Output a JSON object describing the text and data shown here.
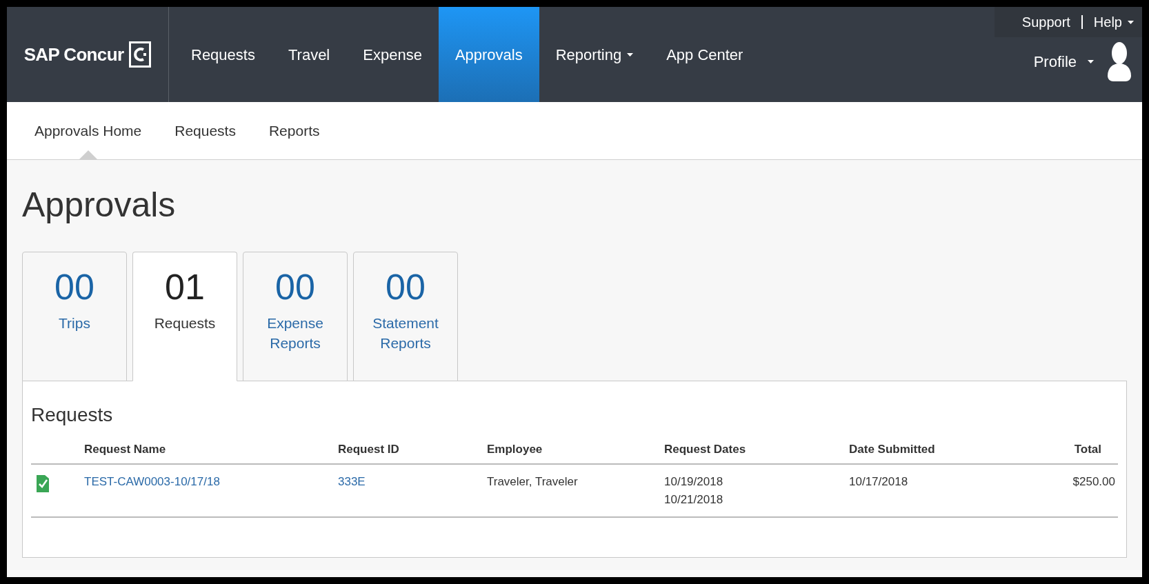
{
  "brand": {
    "name": "SAP Concur"
  },
  "nav": [
    {
      "label": "Requests",
      "selected": false,
      "dropdown": false
    },
    {
      "label": "Travel",
      "selected": false,
      "dropdown": false
    },
    {
      "label": "Expense",
      "selected": false,
      "dropdown": false
    },
    {
      "label": "Approvals",
      "selected": true,
      "dropdown": false
    },
    {
      "label": "Reporting",
      "selected": false,
      "dropdown": true
    },
    {
      "label": "App Center",
      "selected": false,
      "dropdown": false
    }
  ],
  "utility_links": [
    {
      "label": "Support",
      "dropdown": false
    },
    {
      "label": "Help",
      "dropdown": true
    }
  ],
  "profile": {
    "label": "Profile"
  },
  "subnav": [
    {
      "label": "Approvals Home",
      "selected": true
    },
    {
      "label": "Requests",
      "selected": false
    },
    {
      "label": "Reports",
      "selected": false
    }
  ],
  "page_title": "Approvals",
  "tabs": [
    {
      "count": "00",
      "label": "Trips",
      "selected": false
    },
    {
      "count": "01",
      "label": "Requests",
      "selected": true
    },
    {
      "count": "00",
      "label": "Expense Reports",
      "selected": false
    },
    {
      "count": "00",
      "label": "Statement Reports",
      "selected": false
    }
  ],
  "section_title": "Requests",
  "table": {
    "columns": [
      "Request Name",
      "Request ID",
      "Employee",
      "Request Dates",
      "Date Submitted",
      "Total"
    ],
    "rows": [
      {
        "approved": true,
        "name": "TEST-CAW0003-10/17/18",
        "id": "333E",
        "employee": "Traveler, Traveler",
        "dates": [
          "10/19/2018",
          "10/21/2018"
        ],
        "submitted": "10/17/2018",
        "total": "$250.00"
      }
    ]
  }
}
